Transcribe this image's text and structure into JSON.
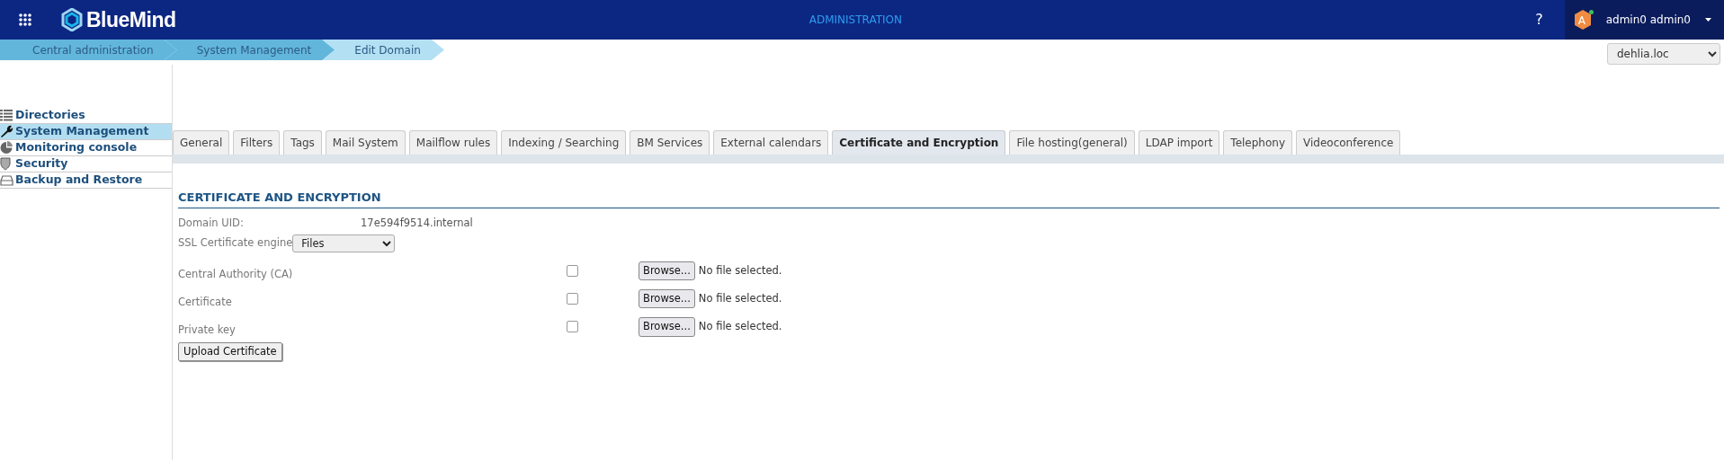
{
  "header": {
    "brand": "BlueMind",
    "title": "ADMINISTRATION",
    "help": "?",
    "user": {
      "initial": "A",
      "name": "admin0 admin0",
      "online": true
    }
  },
  "breadcrumb": [
    {
      "label": "Central administration",
      "selected": false
    },
    {
      "label": "System Management",
      "selected": false
    },
    {
      "label": "Edit Domain",
      "selected": true
    }
  ],
  "domain_select": {
    "value": "dehlia.loc"
  },
  "sidebar": {
    "items": [
      {
        "label": "Directories",
        "selected": false
      },
      {
        "label": "System Management",
        "selected": true
      },
      {
        "label": "Monitoring console",
        "selected": false
      },
      {
        "label": "Security",
        "selected": false
      },
      {
        "label": "Backup and Restore",
        "selected": false
      }
    ]
  },
  "tabs": [
    {
      "label": "General",
      "selected": false
    },
    {
      "label": "Filters",
      "selected": false
    },
    {
      "label": "Tags",
      "selected": false
    },
    {
      "label": "Mail System",
      "selected": false
    },
    {
      "label": "Mailflow rules",
      "selected": false
    },
    {
      "label": "Indexing / Searching",
      "selected": false
    },
    {
      "label": "BM Services",
      "selected": false
    },
    {
      "label": "External calendars",
      "selected": false
    },
    {
      "label": "Certificate and Encryption",
      "selected": true
    },
    {
      "label": "File hosting(general)",
      "selected": false
    },
    {
      "label": "LDAP import",
      "selected": false
    },
    {
      "label": "Telephony",
      "selected": false
    },
    {
      "label": "Videoconference",
      "selected": false
    }
  ],
  "section": {
    "title": "CERTIFICATE AND ENCRYPTION",
    "domain_uid": {
      "label": "Domain UID:",
      "value": "17e594f9514.internal"
    },
    "engine": {
      "label": "SSL Certificate engine",
      "value": "Files"
    },
    "files": [
      {
        "label": "Central Authority (CA)",
        "checked": false,
        "button": "Browse...",
        "status": "No file selected."
      },
      {
        "label": "Certificate",
        "checked": false,
        "button": "Browse...",
        "status": "No file selected."
      },
      {
        "label": "Private key",
        "checked": false,
        "button": "Browse...",
        "status": "No file selected."
      }
    ],
    "upload_button": "Upload Certificate"
  }
}
